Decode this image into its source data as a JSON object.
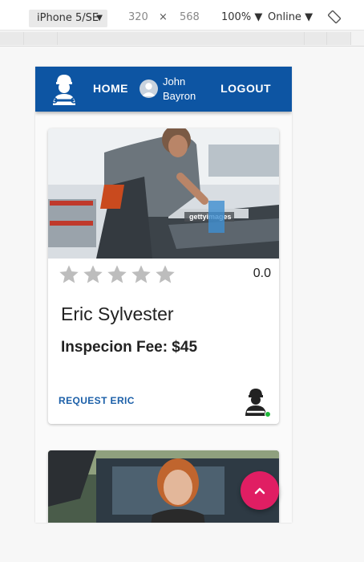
{
  "devtools": {
    "device": "iPhone 5/SE",
    "width": "320",
    "x": "×",
    "height": "568",
    "zoom": "100%",
    "network": "Online",
    "caret": "▼"
  },
  "appbar": {
    "home_label": "HOME",
    "user_name": "John Bayron",
    "logout_label": "LOGOUT",
    "brand_color": "#0d55a3"
  },
  "cards": [
    {
      "rating": 0,
      "rating_text": "0.0",
      "name": "Eric Sylvester",
      "fee": "Inspecion Fee: $45",
      "request_label": "REQUEST ERIC",
      "photo_watermark": "gettyimages",
      "online": true
    }
  ],
  "fab": {
    "icon": "chevron-up-icon",
    "color": "#e01e63"
  },
  "icons": {
    "logo": "mechanic-logo-icon",
    "avatar": "user-avatar-icon",
    "rotate": "rotate-icon",
    "star": "star-icon"
  }
}
